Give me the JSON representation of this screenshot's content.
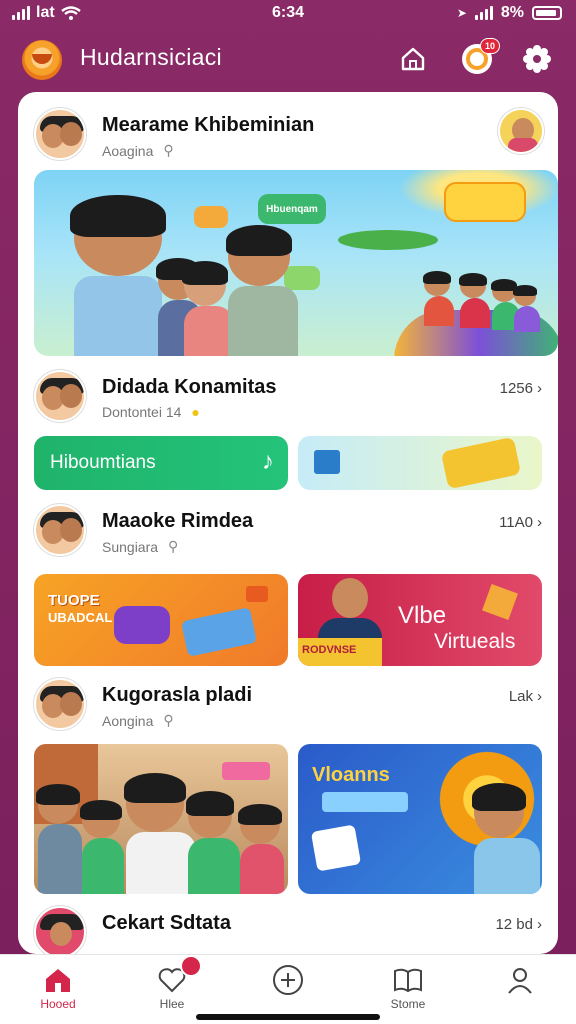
{
  "status_bar": {
    "carrier": "lat",
    "time": "6:34",
    "battery": "8%"
  },
  "header": {
    "app_title": "Hudarnsiciaci",
    "notification_badge": "10"
  },
  "posts": [
    {
      "name": "Mearame Khibeminian",
      "sub": "Aoagina"
    },
    {
      "name": "Didada Konamitas",
      "sub": "Dontontei 14",
      "count": "1256"
    },
    {
      "name": "Maaoke Rimdea",
      "sub": "Sungiara",
      "count": "11A0"
    },
    {
      "name": "Kugorasla pladi",
      "sub": "Aongina",
      "count": "Lak"
    },
    {
      "name": "Cekart Sdtata",
      "count": "12 bd"
    }
  ],
  "banner": {
    "bubble_1": "Hbuenqam"
  },
  "tiles": {
    "green_label": "Hiboumtians",
    "orange_top": "TUOPE",
    "orange_bottom": "UBADCAL",
    "red_title": "Vlbe",
    "red_sub": "Virtueals",
    "red_strip": "RODVNSE",
    "blue_title": "Vloanns"
  },
  "tabs": [
    {
      "label": "Hooed"
    },
    {
      "label": "Hlee"
    },
    {
      "label": ""
    },
    {
      "label": "Stome"
    },
    {
      "label": ""
    }
  ],
  "colors": {
    "brand": "#7a1f5c",
    "accent_green": "#1fb36a",
    "accent_red": "#d4264b"
  }
}
